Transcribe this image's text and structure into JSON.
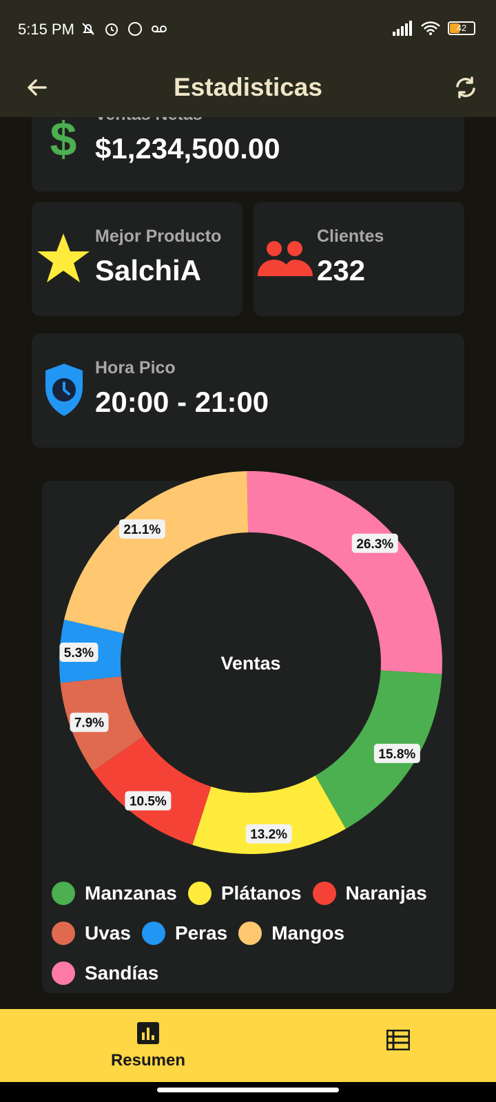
{
  "status": {
    "time": "5:15 PM",
    "battery": "42"
  },
  "appbar": {
    "title": "Estadisticas"
  },
  "cards": {
    "ventas": {
      "label": "Ventas Netas",
      "value": "$1,234,500.00"
    },
    "producto": {
      "label": "Mejor Producto",
      "value": "SalchiA"
    },
    "clientes": {
      "label": "Clientes",
      "value": "232"
    },
    "hora": {
      "label": "Hora Pico",
      "value": "20:00 - 21:00"
    }
  },
  "chart_data": {
    "type": "pie",
    "title": "Ventas",
    "slices": [
      {
        "name": "Sandías",
        "label": "26.3%",
        "value": 26.3,
        "color": "#ff7ba7"
      },
      {
        "name": "Manzanas",
        "label": "15.8%",
        "value": 15.8,
        "color": "#4caf50"
      },
      {
        "name": "Plátanos",
        "label": "13.2%",
        "value": 13.2,
        "color": "#ffeb3b"
      },
      {
        "name": "Naranjas",
        "label": "10.5%",
        "value": 10.5,
        "color": "#f44336"
      },
      {
        "name": "Uvas",
        "label": "7.9%",
        "value": 7.9,
        "color": "#e06a50"
      },
      {
        "name": "Peras",
        "label": "5.3%",
        "value": 5.3,
        "color": "#2196f3"
      },
      {
        "name": "Mangos",
        "label": "21.1%",
        "value": 21.1,
        "color": "#ffc870"
      }
    ],
    "legend": [
      "Manzanas",
      "Plátanos",
      "Naranjas",
      "Uvas",
      "Peras",
      "Mangos",
      "Sandías"
    ]
  },
  "nav": {
    "resumen": "Resumen"
  },
  "colors": {
    "money": "#4caf50",
    "star": "#ffeb3b",
    "people": "#f44336",
    "shield": "#2196f3",
    "nav": "#fdd744"
  }
}
